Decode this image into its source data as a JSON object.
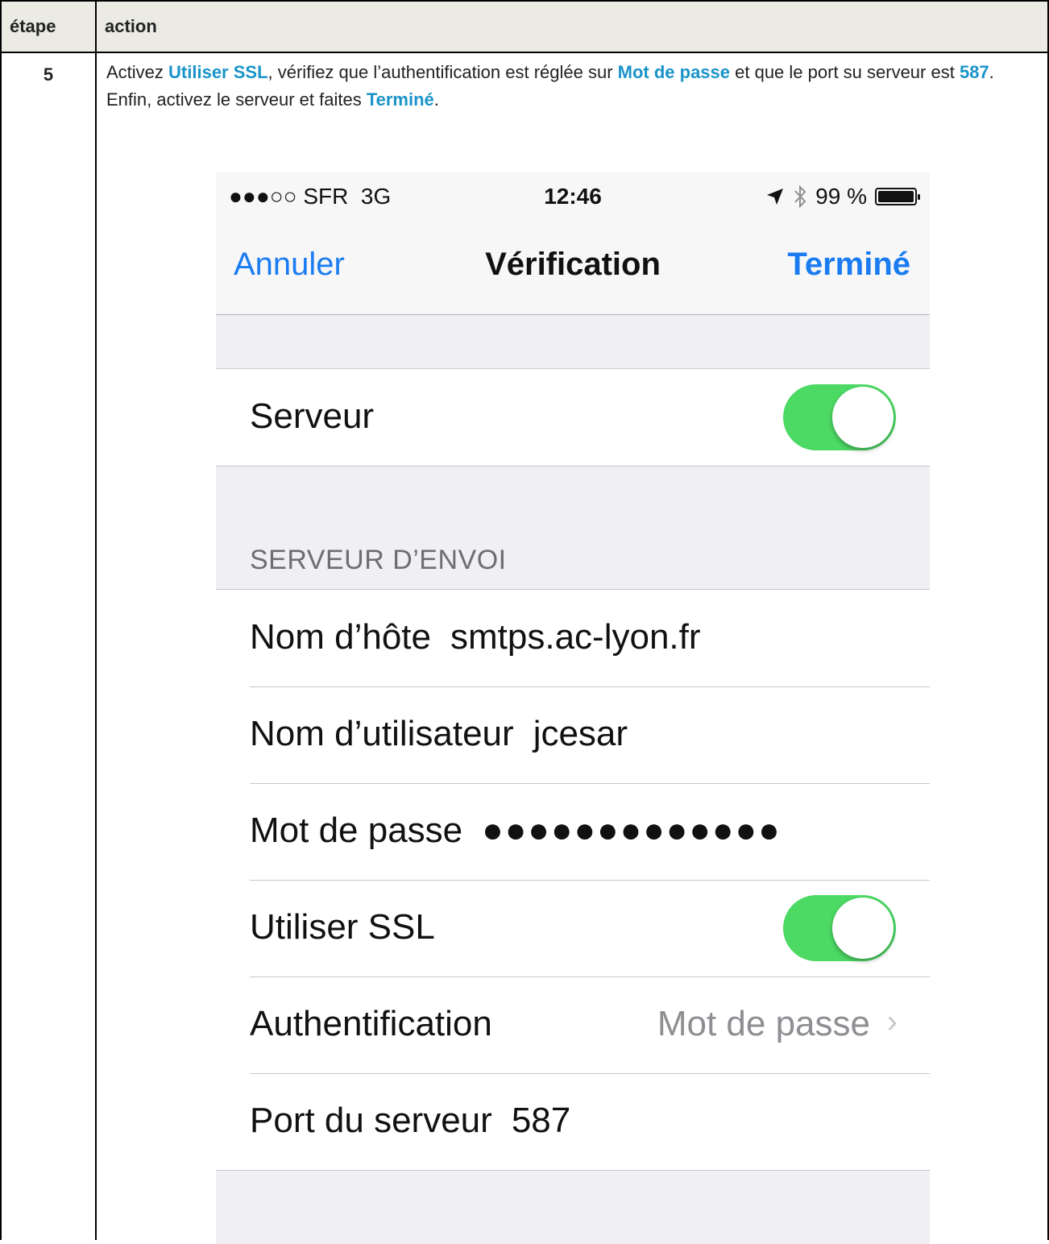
{
  "table": {
    "header": {
      "step": "étape",
      "action": "action"
    },
    "row": {
      "step": "5",
      "line1": [
        {
          "t": "Activez ",
          "b": false
        },
        {
          "t": "Utiliser SSL",
          "b": true
        },
        {
          "t": ", vérifiez que l’authentification est réglée sur ",
          "b": false
        },
        {
          "t": "Mot de passe",
          "b": true
        },
        {
          "t": " et que le port su serveur est ",
          "b": false
        },
        {
          "t": "587",
          "b": true
        },
        {
          "t": ".",
          "b": false
        }
      ],
      "line2": [
        {
          "t": "Enfin, activez le serveur et faites ",
          "b": false
        },
        {
          "t": "Terminé",
          "b": true
        },
        {
          "t": ".",
          "b": false
        }
      ]
    }
  },
  "phone": {
    "status": {
      "signal": "●●●○○",
      "carrier": "SFR",
      "network": "3G",
      "time": "12:46",
      "battery": "99 %",
      "battery_level": 0.99
    },
    "nav": {
      "cancel": "Annuler",
      "title": "Vérification",
      "done": "Terminé"
    },
    "server_row": {
      "label": "Serveur",
      "on": true
    },
    "section_header": "SERVEUR D’ENVOI",
    "fields": {
      "hostname": {
        "label": "Nom d’hôte",
        "value": "smtps.ac-lyon.fr"
      },
      "username": {
        "label": "Nom d’utilisateur",
        "value": "jcesar"
      },
      "password": {
        "label": "Mot de passe",
        "value": "●●●●●●●●●●●●●"
      },
      "ssl": {
        "label": "Utiliser SSL",
        "on": true
      },
      "auth": {
        "label": "Authentification",
        "value": "Mot de passe",
        "chevron": "›"
      },
      "port": {
        "label": "Port du serveur",
        "value": "587"
      }
    },
    "colors": {
      "ios_blue": "#1a7cf0",
      "toggle_green": "#4cd964",
      "doc_highlight": "#1a94c9"
    }
  }
}
